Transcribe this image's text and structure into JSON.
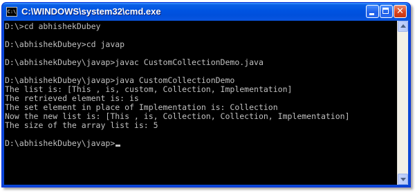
{
  "window": {
    "title": "C:\\WINDOWS\\system32\\cmd.exe",
    "icon_name": "cmd-icon",
    "icon_label": "C:\\",
    "controls": {
      "minimize_icon": "minimize-icon",
      "maximize_icon": "maximize-icon",
      "close_icon": "close-icon",
      "close_glyph": "✕"
    }
  },
  "console": {
    "background": "#000000",
    "foreground": "#c0c0c0",
    "lines": [
      "D:\\>cd abhishekDubey",
      "",
      "D:\\abhishekDubey>cd javap",
      "",
      "D:\\abhishekDubey\\javap>javac CustomCollectionDemo.java",
      "",
      "D:\\abhishekDubey\\javap>java CustomCollectionDemo",
      "The list is: [This , is, custom, Collection, Implementation]",
      "The retrieved element is: is",
      "The set element in place of Implementation is: Collection",
      "Now the new list is: [This , is, Collection, Collection, Implementation]",
      "The size of the array list is: 5",
      "",
      "D:\\abhishekDubey\\javap>"
    ]
  },
  "colors": {
    "titlebar_blue": "#0053e1",
    "close_button_red": "#d9441f",
    "frame_blue": "#0a46d6"
  }
}
